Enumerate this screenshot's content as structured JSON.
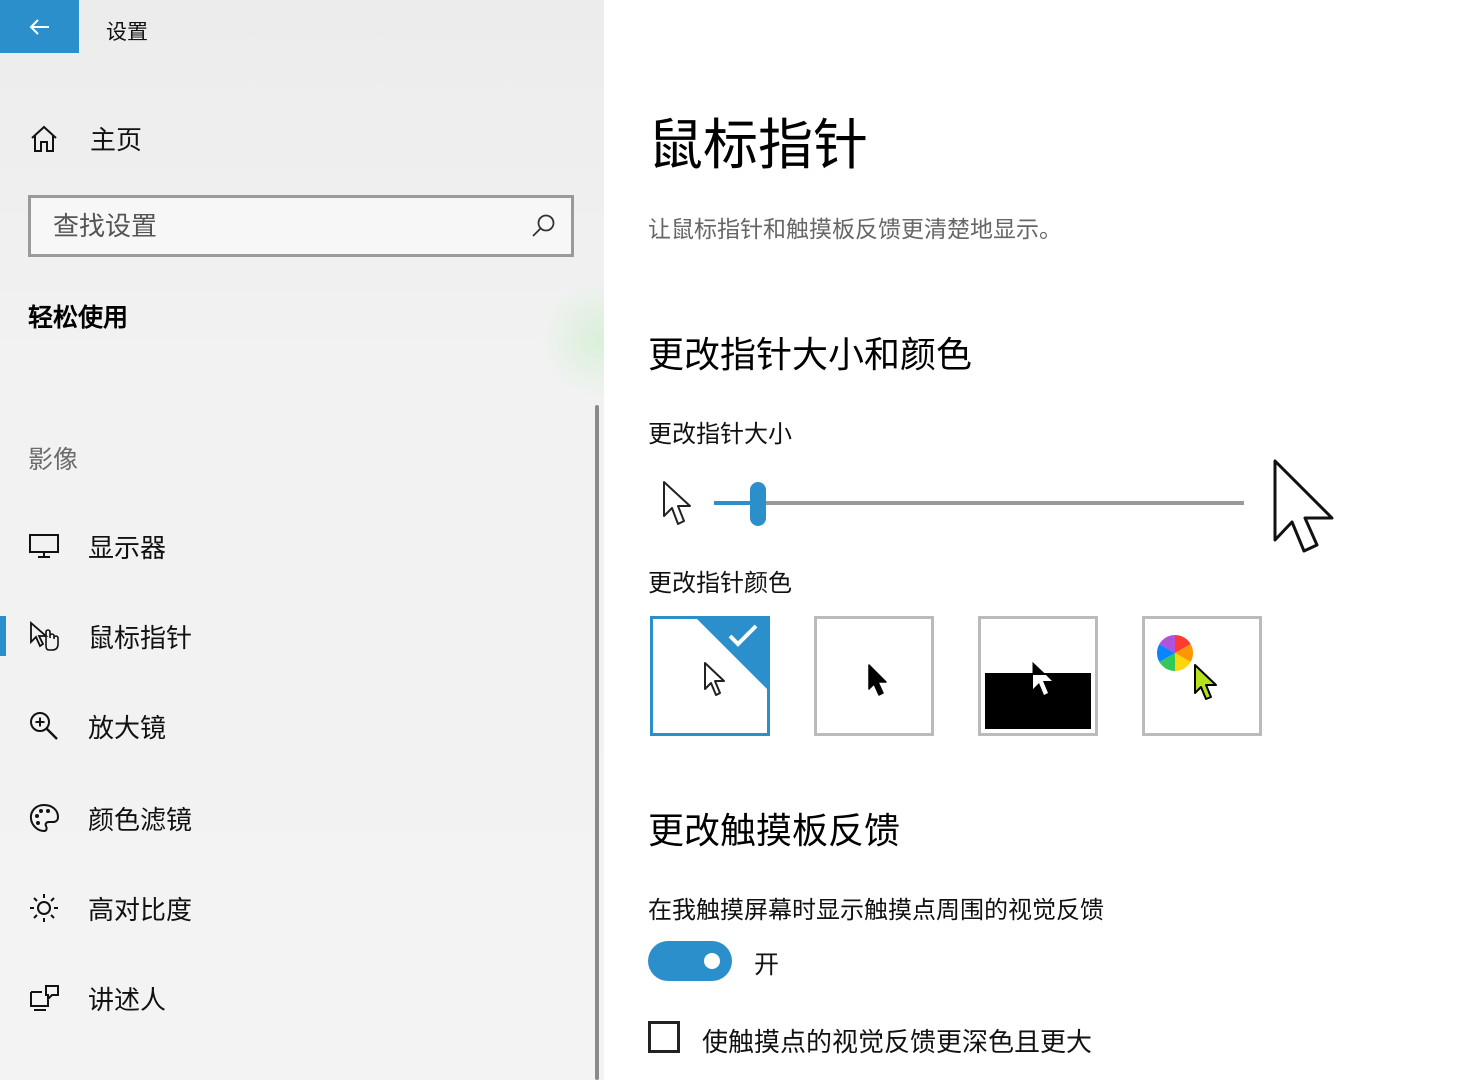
{
  "window": {
    "title": "设置"
  },
  "sidebar": {
    "home_label": "主页",
    "search_placeholder": "查找设置",
    "section_title": "轻松使用",
    "category_label": "影像",
    "items": [
      {
        "label": "显示器",
        "icon": "monitor-icon",
        "active": false
      },
      {
        "label": "鼠标指针",
        "icon": "mouse-pointer-icon",
        "active": true
      },
      {
        "label": "放大镜",
        "icon": "magnifier-icon",
        "active": false
      },
      {
        "label": "颜色滤镜",
        "icon": "palette-icon",
        "active": false
      },
      {
        "label": "高对比度",
        "icon": "brightness-icon",
        "active": false
      },
      {
        "label": "讲述人",
        "icon": "narrator-icon",
        "active": false
      }
    ]
  },
  "main": {
    "title": "鼠标指针",
    "description": "让鼠标指针和触摸板反馈更清楚地显示。",
    "size_color_heading": "更改指针大小和颜色",
    "size_label": "更改指针大小",
    "size_value": 1,
    "size_min": 1,
    "size_max": 15,
    "color_label": "更改指针颜色",
    "color_options": [
      {
        "name": "white",
        "selected": true
      },
      {
        "name": "black",
        "selected": false
      },
      {
        "name": "inverted",
        "selected": false
      },
      {
        "name": "custom",
        "selected": false
      }
    ],
    "touch_heading": "更改触摸板反馈",
    "touch_feedback_label": "在我触摸屏幕时显示触摸点周围的视觉反馈",
    "touch_feedback_state": "开",
    "touch_feedback_on": true,
    "darker_label": "使触摸点的视觉反馈更深色且更大",
    "darker_checked": false
  },
  "colors": {
    "accent": "#2b8fcc",
    "custom_cursor": "#b6e21b"
  }
}
